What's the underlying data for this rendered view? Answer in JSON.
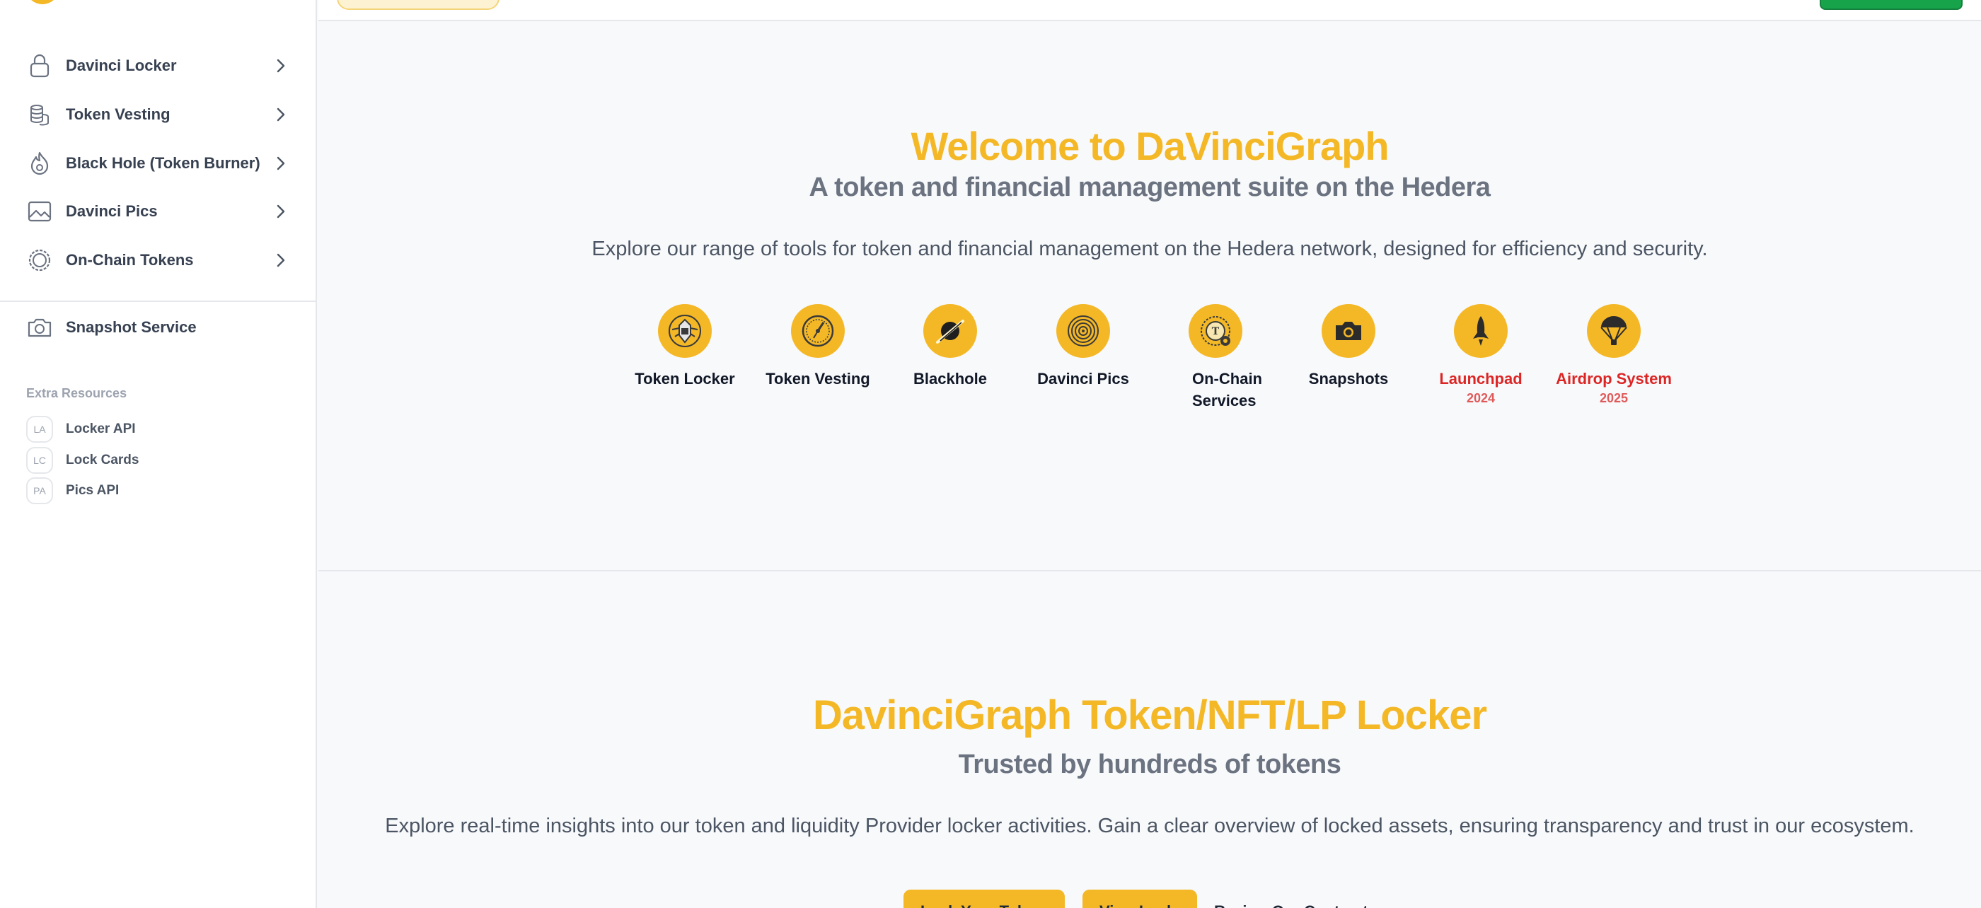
{
  "sidebar": {
    "items": [
      {
        "label": "Davinci Locker",
        "icon": "lock-icon"
      },
      {
        "label": "Token Vesting",
        "icon": "coins-stack-icon"
      },
      {
        "label": "Black Hole (Token Burner)",
        "icon": "flame-icon"
      },
      {
        "label": "Davinci Pics",
        "icon": "image-icon"
      },
      {
        "label": "On-Chain Tokens",
        "icon": "token-coin-icon"
      }
    ],
    "snapshot": {
      "label": "Snapshot Service",
      "icon": "camera-icon"
    },
    "extra_title": "Extra Resources",
    "resources": [
      {
        "badge": "LA",
        "label": "Locker API"
      },
      {
        "badge": "LC",
        "label": "Lock Cards"
      },
      {
        "badge": "PA",
        "label": "Pics API"
      }
    ]
  },
  "hero": {
    "title": "Welcome to DaVinciGraph",
    "subtitle": "A token and financial management suite on the Hedera",
    "description": "Explore our range of tools for token and financial management on the Hedera network, designed for efficiency and security."
  },
  "tools": [
    {
      "label": "Token Locker",
      "icon": "token-locker-icon"
    },
    {
      "label": "Token Vesting",
      "icon": "token-vesting-icon"
    },
    {
      "label": "Blackhole",
      "icon": "blackhole-icon"
    },
    {
      "label": "Davinci Pics",
      "icon": "davinci-pics-icon"
    },
    {
      "label": "On-Chain Services",
      "icon": "on-chain-services-icon"
    },
    {
      "label": "Snapshots",
      "icon": "snapshots-icon"
    },
    {
      "label": "Launchpad",
      "year": "2024",
      "icon": "rocket-icon"
    },
    {
      "label": "Airdrop System",
      "year": "2025",
      "icon": "parachute-icon"
    }
  ],
  "locker": {
    "title": "DavinciGraph Token/NFT/LP Locker",
    "subtitle": "Trusted by hundreds of tokens",
    "description": "Explore real-time insights into our token and liquidity Provider locker activities. Gain a clear overview of locked assets, ensuring transparency and trust in our ecosystem.",
    "buttons": {
      "lock": "Lock Your Tokens",
      "view": "View Locks",
      "review": "Review Our Contract"
    }
  },
  "colors": {
    "accent": "#f4b827",
    "soon": "#dc2626",
    "connect": "#16a34a"
  }
}
